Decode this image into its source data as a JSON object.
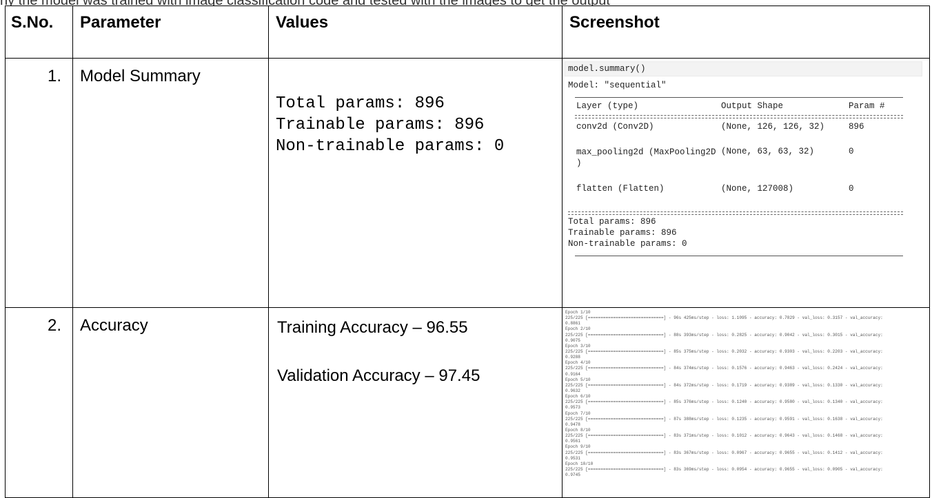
{
  "top_text": "ny the model was trained with image classification code and tested with the images to get the output",
  "headers": {
    "sno": "S.No.",
    "parameter": "Parameter",
    "values": "Values",
    "screenshot": "Screenshot"
  },
  "rows": [
    {
      "sno": "1.",
      "parameter": "Model Summary",
      "values_text": "Total params: 896\nTrainable params: 896\nNon-trainable params: 0",
      "screenshot": {
        "command": "model.summary()",
        "model_line": "Model: \"sequential\"",
        "col_layer": "Layer (type)",
        "col_shape": "Output Shape",
        "col_param": "Param #",
        "equals_line": "===========================================================",
        "layers": [
          {
            "name": "conv2d (Conv2D)",
            "shape": "(None, 126, 126, 32)",
            "params": "896"
          },
          {
            "name": "max_pooling2d (MaxPooling2D\n)",
            "shape": "(None, 63, 63, 32)",
            "params": "0"
          },
          {
            "name": "flatten (Flatten)",
            "shape": "(None, 127008)",
            "params": "0"
          }
        ],
        "total": "Total params: 896",
        "trainable": "Trainable params: 896",
        "non_trainable": "Non-trainable params: 0"
      }
    },
    {
      "sno": "2.",
      "parameter": "Accuracy",
      "training_accuracy": "Training Accuracy – 96.55",
      "validation_accuracy": "Validation Accuracy – 97.45",
      "log_lines": [
        "Epoch 1/10",
        "225/225 [==============================] - 96s 425ms/step - loss: 1.1095 - accuracy: 0.7829 - val_loss: 0.3157 - val_accuracy:",
        "0.8861",
        "Epoch 2/10",
        "225/225 [==============================] - 88s 393ms/step - loss: 0.2825 - accuracy: 0.9042 - val_loss: 0.3015 - val_accuracy:",
        "0.9075",
        "Epoch 3/10",
        "225/225 [==============================] - 85s 375ms/step - loss: 0.2032 - accuracy: 0.9303 - val_loss: 0.2203 - val_accuracy:",
        "0.9288",
        "Epoch 4/10",
        "225/225 [==============================] - 84s 374ms/step - loss: 0.1576 - accuracy: 0.9463 - val_loss: 0.2424 - val_accuracy:",
        "0.9164",
        "Epoch 5/10",
        "225/225 [==============================] - 84s 372ms/step - loss: 0.1719 - accuracy: 0.9389 - val_loss: 0.1330 - val_accuracy:",
        "0.9632",
        "Epoch 6/10",
        "225/225 [==============================] - 85s 376ms/step - loss: 0.1240 - accuracy: 0.9580 - val_loss: 0.1340 - val_accuracy:",
        "0.9573",
        "Epoch 7/10",
        "225/225 [==============================] - 87s 388ms/step - loss: 0.1235 - accuracy: 0.9591 - val_loss: 0.1638 - val_accuracy:",
        "0.9478",
        "Epoch 8/10",
        "225/225 [==============================] - 83s 371ms/step - loss: 0.1012 - accuracy: 0.9643 - val_loss: 0.1468 - val_accuracy:",
        "0.9561",
        "Epoch 9/10",
        "225/225 [==============================] - 83s 367ms/step - loss: 0.0967 - accuracy: 0.9655 - val_loss: 0.1412 - val_accuracy:",
        "0.9531",
        "Epoch 10/10",
        "225/225 [==============================] - 83s 369ms/step - loss: 0.0954 - accuracy: 0.9655 - val_loss: 0.0905 - val_accuracy:",
        "0.9745"
      ]
    }
  ]
}
